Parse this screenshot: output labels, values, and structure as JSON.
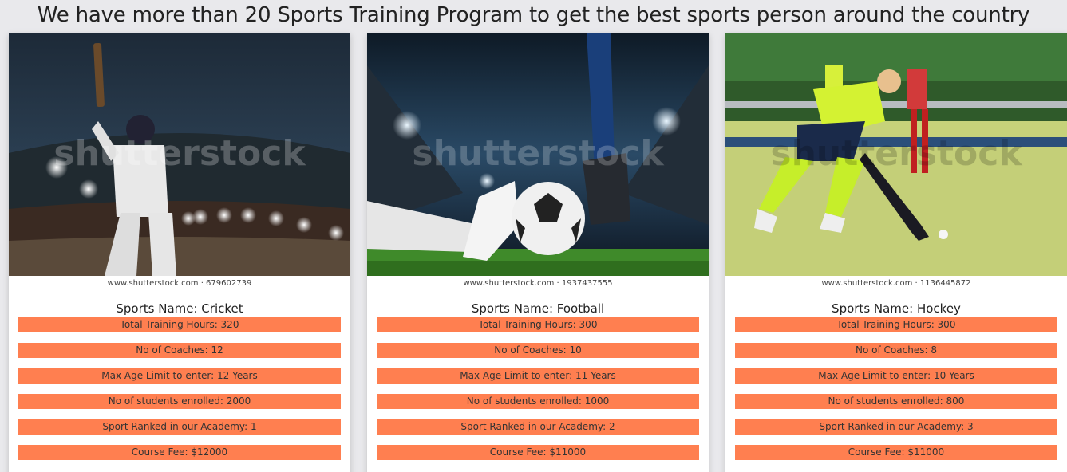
{
  "page": {
    "title": "We have more than 20 Sports Training Program to get the best sports person around the country"
  },
  "cards": [
    {
      "image_caption": "www.shutterstock.com · 679602739",
      "watermark": "shutterstock",
      "sport_name": "Sports Name: Cricket",
      "stats": [
        "Total Training Hours: 320",
        "No of Coaches: 12",
        "Max Age Limit to enter: 12 Years",
        "No of students enrolled: 2000",
        "Sport Ranked in our Academy: 1",
        "Course Fee: $12000"
      ]
    },
    {
      "image_caption": "www.shutterstock.com · 1937437555",
      "watermark": "shutterstock",
      "sport_name": "Sports Name: Football",
      "stats": [
        "Total Training Hours: 300",
        "No of Coaches: 10",
        "Max Age Limit to enter: 11 Years",
        "No of students enrolled: 1000",
        "Sport Ranked in our Academy: 2",
        "Course Fee: $11000"
      ]
    },
    {
      "image_caption": "www.shutterstock.com · 1136445872",
      "watermark": "shutterstock",
      "sport_name": "Sports Name: Hockey",
      "stats": [
        "Total Training Hours: 300",
        "No of Coaches: 8",
        "Max Age Limit to enter: 10 Years",
        "No of students enrolled: 800",
        "Sport Ranked in our Academy: 3",
        "Course Fee: $11000"
      ]
    }
  ],
  "colors": {
    "stat_bar": "#ff7f50",
    "page_bg": "#e9e9ec",
    "card_bg": "#ffffff"
  }
}
